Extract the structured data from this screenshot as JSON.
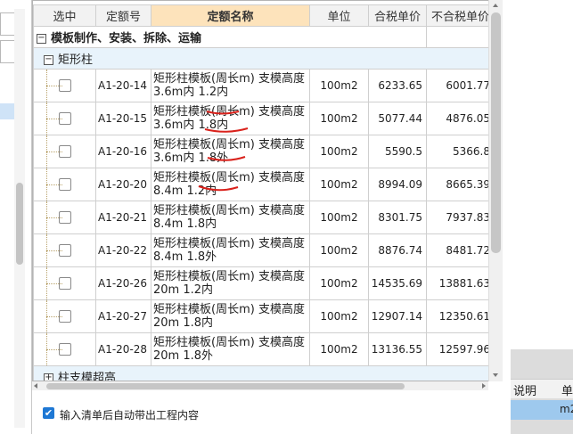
{
  "columns": {
    "select": "选中",
    "code": "定额号",
    "name": "定额名称",
    "unit": "单位",
    "price_tax": "合税单价",
    "price_notax": "不合税单价"
  },
  "group": {
    "expander": "−",
    "title": "模板制作、安装、拆除、运输"
  },
  "subgroup": {
    "expander": "−",
    "title": "矩形柱"
  },
  "rows": [
    {
      "code": "A1-20-14",
      "name": "矩形柱模板(周长m) 支模高度3.6m内 1.2内",
      "unit": "100m2",
      "price_tax": "6233.65",
      "price_notax": "6001.77"
    },
    {
      "code": "A1-20-15",
      "name": "矩形柱模板(周长m) 支模高度3.6m内 1.8内",
      "unit": "100m2",
      "price_tax": "5077.44",
      "price_notax": "4876.05"
    },
    {
      "code": "A1-20-16",
      "name": "矩形柱模板(周长m) 支模高度3.6m内 1.8外",
      "unit": "100m2",
      "price_tax": "5590.5",
      "price_notax": "5366.8"
    },
    {
      "code": "A1-20-20",
      "name": "矩形柱模板(周长m) 支模高度8.4m 1.2内",
      "unit": "100m2",
      "price_tax": "8994.09",
      "price_notax": "8665.39"
    },
    {
      "code": "A1-20-21",
      "name": "矩形柱模板(周长m) 支模高度8.4m 1.8内",
      "unit": "100m2",
      "price_tax": "8301.75",
      "price_notax": "7937.83"
    },
    {
      "code": "A1-20-22",
      "name": "矩形柱模板(周长m) 支模高度8.4m 1.8外",
      "unit": "100m2",
      "price_tax": "8876.74",
      "price_notax": "8481.72"
    },
    {
      "code": "A1-20-26",
      "name": "矩形柱模板(周长m) 支模高度20m 1.2内",
      "unit": "100m2",
      "price_tax": "14535.69",
      "price_notax": "13881.63"
    },
    {
      "code": "A1-20-27",
      "name": "矩形柱模板(周长m) 支模高度20m 1.8内",
      "unit": "100m2",
      "price_tax": "12907.14",
      "price_notax": "12350.61"
    },
    {
      "code": "A1-20-28",
      "name": "矩形柱模板(周长m) 支模高度20m 1.8外",
      "unit": "100m2",
      "price_tax": "13136.55",
      "price_notax": "12597.96"
    }
  ],
  "next_subgroup": {
    "expander": "+",
    "title": "柱支模超高"
  },
  "footer": {
    "auto_checkbox_checked": true,
    "auto_label": "输入清单后自动带出工程内容"
  },
  "right_panel": {
    "header_1": "说明",
    "header_2": "单",
    "unit_value": "m2"
  },
  "colors": {
    "header_highlight": "#fde3bb",
    "subgroup_bg": "#e8f3fb",
    "annotation_red": "#d9211b",
    "checkbox_blue": "#1e78d4"
  }
}
